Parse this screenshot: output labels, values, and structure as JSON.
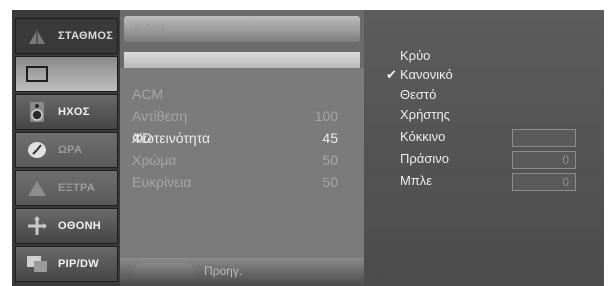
{
  "nav": {
    "items": [
      {
        "label": "ΣΤΑΘΜΟΣ",
        "icon": "station-icon",
        "state": "top"
      },
      {
        "label": "",
        "icon": "picture-icon",
        "state": "selected"
      },
      {
        "label": "ΗΧΟΣ",
        "icon": "speaker-icon",
        "state": "bright"
      },
      {
        "label": "ΩΡΑ",
        "icon": "clock-icon",
        "state": "dim"
      },
      {
        "label": "ΕΞΤΡΑ",
        "icon": "extra-icon",
        "state": "dim"
      },
      {
        "label": "ΟΘΟΝΗ",
        "icon": "screen-icon",
        "state": "bright"
      },
      {
        "label": "PIP/DW",
        "icon": "pip-icon",
        "state": "bright"
      }
    ]
  },
  "picture": {
    "top_label": "P.S.M",
    "xd_label": "XD",
    "rows": [
      {
        "label": "ACM",
        "value": ""
      },
      {
        "label": "Αντίθεση",
        "value": "100"
      },
      {
        "label": "Φωτεινότητα",
        "value": "45"
      },
      {
        "label": "Χρώμα",
        "value": "50"
      },
      {
        "label": "Ευκρίνεια",
        "value": "50"
      }
    ],
    "prev_label": "Προηγ."
  },
  "color_temp": {
    "options": [
      "Κρύο",
      "Κανονικό",
      "Θεστό",
      "Χρήστης",
      "Κόκκινο",
      "Πράσινο",
      "Μπλε"
    ],
    "selected": "Κανονικό",
    "check_mark": "✔",
    "user_values": {
      "Κόκκινο": "",
      "Πράσινο": "0",
      "Μπλε": "0"
    }
  }
}
